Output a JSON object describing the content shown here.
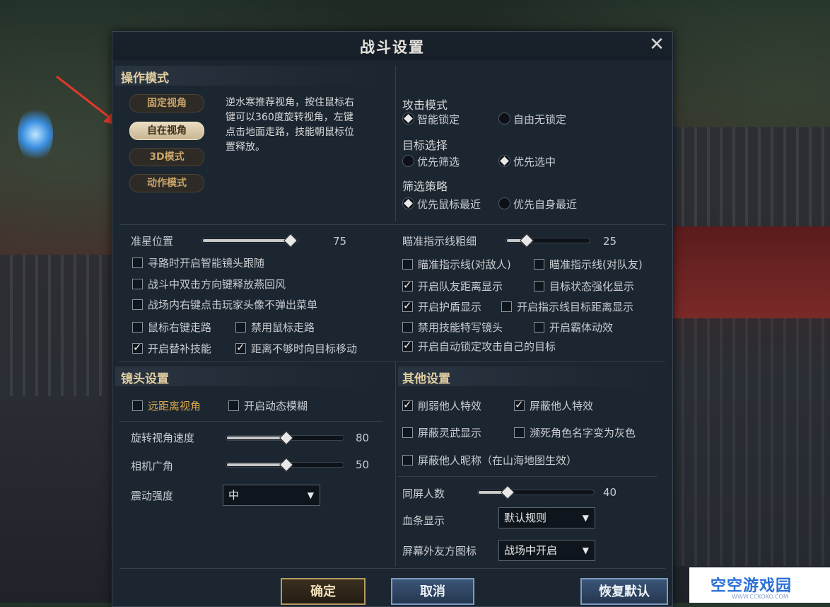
{
  "window": {
    "title": "战斗设置",
    "close_icon": "close-icon"
  },
  "operation_mode": {
    "section_title": "操作模式",
    "modes": [
      {
        "label": "固定视角",
        "active": false
      },
      {
        "label": "自在视角",
        "active": true
      },
      {
        "label": "3D模式",
        "active": false
      },
      {
        "label": "动作模式",
        "active": false
      }
    ],
    "description": [
      "逆水寒推荐视角，按住鼠标右",
      "键可以360度旋转视角，左键",
      "点击地面走路，技能朝鼠标位",
      "置释放。"
    ],
    "attack_mode": {
      "label": "攻击模式",
      "options": [
        {
          "label": "智能锁定",
          "selected": true
        },
        {
          "label": "自由无锁定",
          "selected": false
        }
      ]
    },
    "target_select": {
      "label": "目标选择",
      "options": [
        {
          "label": "优先筛选",
          "selected": false
        },
        {
          "label": "优先选中",
          "selected": true
        }
      ]
    },
    "filter_strategy": {
      "label": "筛选策略",
      "options": [
        {
          "label": "优先鼠标最近",
          "selected": true
        },
        {
          "label": "优先自身最近",
          "selected": false
        }
      ]
    }
  },
  "combat": {
    "crosshair": {
      "label": "准星位置",
      "value": "75",
      "fraction": 0.75
    },
    "aim_line": {
      "label": "瞄准指示线粗细",
      "value": "25",
      "fraction": 0.25
    },
    "left_checks": [
      {
        "label": "寻路时开启智能镜头跟随",
        "checked": false
      },
      {
        "label": "战斗中双击方向键释放燕回风",
        "checked": false
      },
      {
        "label": "战场内右键点击玩家头像不弹出菜单",
        "checked": false
      },
      {
        "label": "鼠标右键走路",
        "checked": false
      },
      {
        "label": "禁用鼠标走路",
        "checked": false
      },
      {
        "label": "开启替补技能",
        "checked": true
      },
      {
        "label": "距离不够时向目标移动",
        "checked": true
      }
    ],
    "right_checks": [
      {
        "label": "瞄准指示线(对敌人)",
        "checked": false
      },
      {
        "label": "瞄准指示线(对队友)",
        "checked": false
      },
      {
        "label": "开启队友距离显示",
        "checked": true
      },
      {
        "label": "目标状态强化显示",
        "checked": false
      },
      {
        "label": "开启护盾显示",
        "checked": true
      },
      {
        "label": "开启指示线目标距离显示",
        "checked": false
      },
      {
        "label": "禁用技能特写镜头",
        "checked": false
      },
      {
        "label": "开启霸体动效",
        "checked": false
      },
      {
        "label": "开启自动锁定攻击自己的目标",
        "checked": true
      }
    ]
  },
  "camera": {
    "section_title": "镜头设置",
    "far_view": {
      "label": "远距离视角",
      "checked": false
    },
    "motion_blur": {
      "label": "开启动态模糊",
      "checked": false
    },
    "rotate_speed": {
      "label": "旋转视角速度",
      "value": "80",
      "fraction": 0.5
    },
    "fov": {
      "label": "相机广角",
      "value": "50",
      "fraction": 0.5
    },
    "shake": {
      "label": "震动强度",
      "value": "中"
    }
  },
  "other": {
    "section_title": "其他设置",
    "checks": [
      {
        "label": "削弱他人特效",
        "checked": true
      },
      {
        "label": "屏蔽他人特效",
        "checked": true
      },
      {
        "label": "屏蔽灵武显示",
        "checked": false
      },
      {
        "label": "濒死角色名字变为灰色",
        "checked": false
      },
      {
        "label": "屏蔽他人昵称（在山海地图生效）",
        "checked": false
      }
    ],
    "same_screen": {
      "label": "同屏人数",
      "value": "40",
      "fraction": 0.25
    },
    "hp_bar": {
      "label": "血条显示",
      "value": "默认规则"
    },
    "offscreen_icon": {
      "label": "屏幕外友方图标",
      "value": "战场中开启"
    }
  },
  "buttons": {
    "confirm": "确定",
    "cancel": "取消",
    "reset": "恢复默认"
  },
  "watermark": {
    "text": "空空游戏园",
    "sub": "WWW.CCKOKO.COM"
  }
}
